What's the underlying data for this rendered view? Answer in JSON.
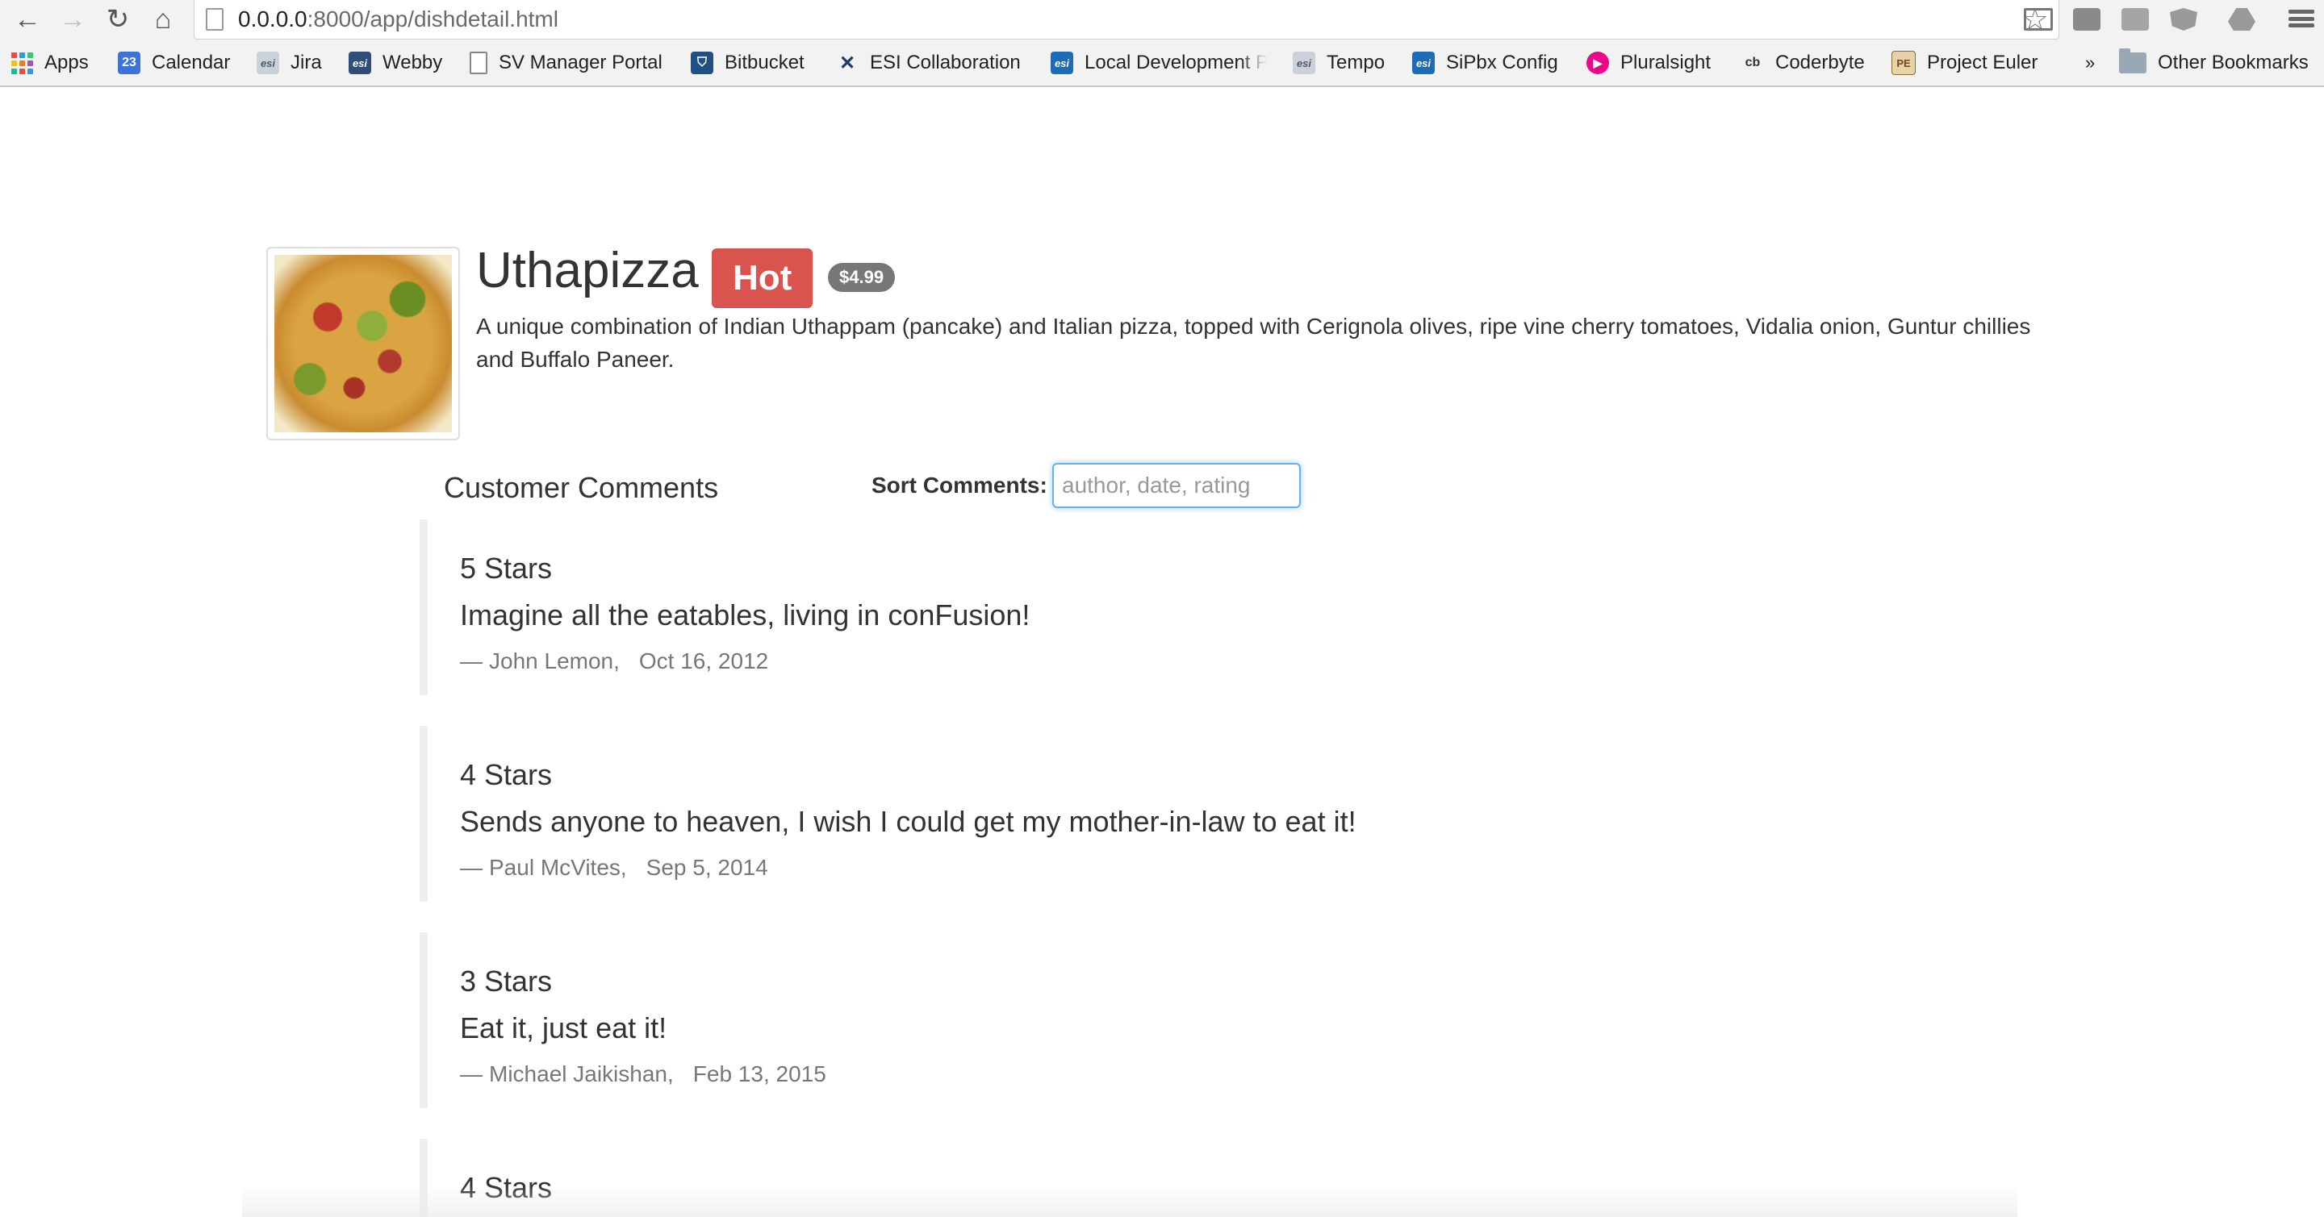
{
  "browser": {
    "url_host": "0.0.0.0",
    "url_path": ":8000/app/dishdetail.html",
    "bookmarks": [
      {
        "label": "Apps",
        "icon": "apps-grid-icon"
      },
      {
        "label": "Calendar",
        "icon": "calendar-icon",
        "icon_text": "23",
        "color": "#3b73d9"
      },
      {
        "label": "Jira",
        "icon": "esi-icon",
        "icon_text": "esi",
        "color": "#9aa7b5"
      },
      {
        "label": "Webby",
        "icon": "esi-icon",
        "icon_text": "esi",
        "color": "#2f4f7a"
      },
      {
        "label": "SV Manager Portal",
        "icon": "page-icon"
      },
      {
        "label": "Bitbucket",
        "icon": "bitbucket-icon",
        "icon_text": "⛉",
        "color": "#205081"
      },
      {
        "label": "ESI Collaboration",
        "icon": "x-icon",
        "icon_text": "✕",
        "color": "#1f3b66"
      },
      {
        "label": "Local Development P",
        "icon": "esi-icon",
        "icon_text": "esi",
        "color": "#1e6bb8"
      },
      {
        "label": "Tempo",
        "icon": "esi-icon",
        "icon_text": "esi",
        "color": "#9aa7b5"
      },
      {
        "label": "SiPbx Config",
        "icon": "esi-icon",
        "icon_text": "esi",
        "color": "#1e6bb8"
      },
      {
        "label": "Pluralsight",
        "icon": "pluralsight-icon",
        "icon_text": "▶",
        "color": "#e80a89"
      },
      {
        "label": "Coderbyte",
        "icon": "coderbyte-icon",
        "icon_text": "cb",
        "color": "#ffffff"
      },
      {
        "label": "Project Euler",
        "icon": "project-euler-icon",
        "icon_text": "PE",
        "color": "#c8a060"
      }
    ],
    "overflow": "»",
    "other_bookmarks": "Other Bookmarks"
  },
  "dish": {
    "name": "Uthapizza",
    "label": "Hot",
    "price": "$4.99",
    "description": "A unique combination of Indian Uthappam (pancake) and Italian pizza, topped with Cerignola olives, ripe vine cherry tomatoes, Vidalia onion, Guntur chillies and Buffalo Paneer."
  },
  "comments_section": {
    "heading": "Customer Comments",
    "sort_label": "Sort Comments:",
    "sort_placeholder": "author, date, rating",
    "sort_value": ""
  },
  "comments": [
    {
      "rating": "5 Stars",
      "comment": "Imagine all the eatables, living in conFusion!",
      "author": "John Lemon,",
      "date": "Oct 16, 2012"
    },
    {
      "rating": "4 Stars",
      "comment": "Sends anyone to heaven, I wish I could get my mother-in-law to eat it!",
      "author": "Paul McVites,",
      "date": "Sep 5, 2014"
    },
    {
      "rating": "3 Stars",
      "comment": "Eat it, just eat it!",
      "author": "Michael Jaikishan,",
      "date": "Feb 13, 2015"
    },
    {
      "rating": "4 Stars",
      "comment": "",
      "author": "",
      "date": ""
    }
  ],
  "meta_dash": "—"
}
